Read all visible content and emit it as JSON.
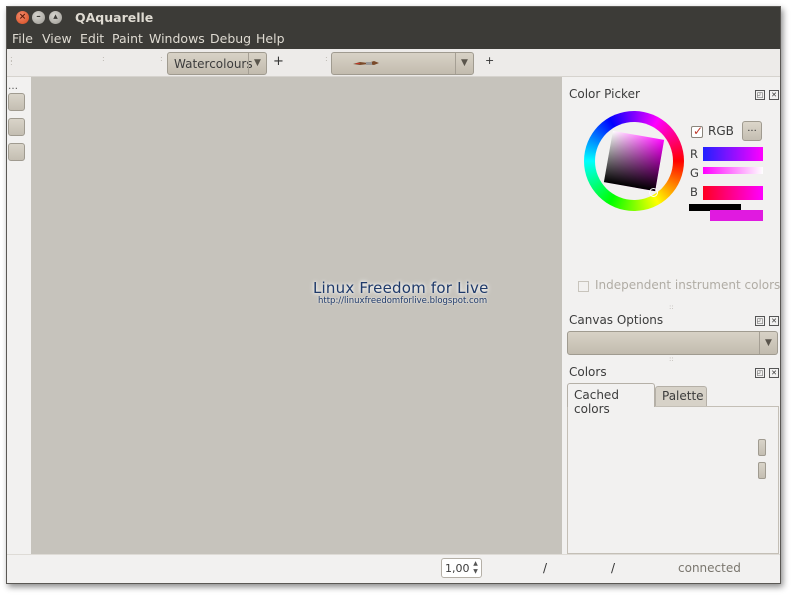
{
  "window": {
    "title": "QAquarelle"
  },
  "menu": [
    "File",
    "View",
    "Edit",
    "Paint",
    "Windows",
    "Debug",
    "Help"
  ],
  "toolbar": {
    "palette_combo": "Watercolours",
    "add1": "+",
    "add2": "+"
  },
  "canvas": {
    "watermark_title": "Linux Freedom for Live",
    "watermark_url": "http://linuxfreedomforlive.blogspot.com"
  },
  "color_picker": {
    "title": "Color Picker",
    "rgb_label": "RGB",
    "rgb_checked": true,
    "more_button": "...",
    "channels": [
      {
        "label": "R"
      },
      {
        "label": "G"
      },
      {
        "label": "B"
      }
    ],
    "independent_label": "Independent instrument colors",
    "current_color": "#e01ae0"
  },
  "canvas_options": {
    "title": "Canvas Options"
  },
  "colors": {
    "title": "Colors",
    "tabs": [
      "Cached colors",
      "Palette"
    ]
  },
  "statusbar": {
    "zoom_value": "1,00",
    "sep1": "/",
    "sep2": "/",
    "status": "connected"
  },
  "colors_theme": {
    "titlebar": "#3c3b37",
    "canvas_bg": "#c6c3bc",
    "window_bg": "#f2f1f0"
  }
}
